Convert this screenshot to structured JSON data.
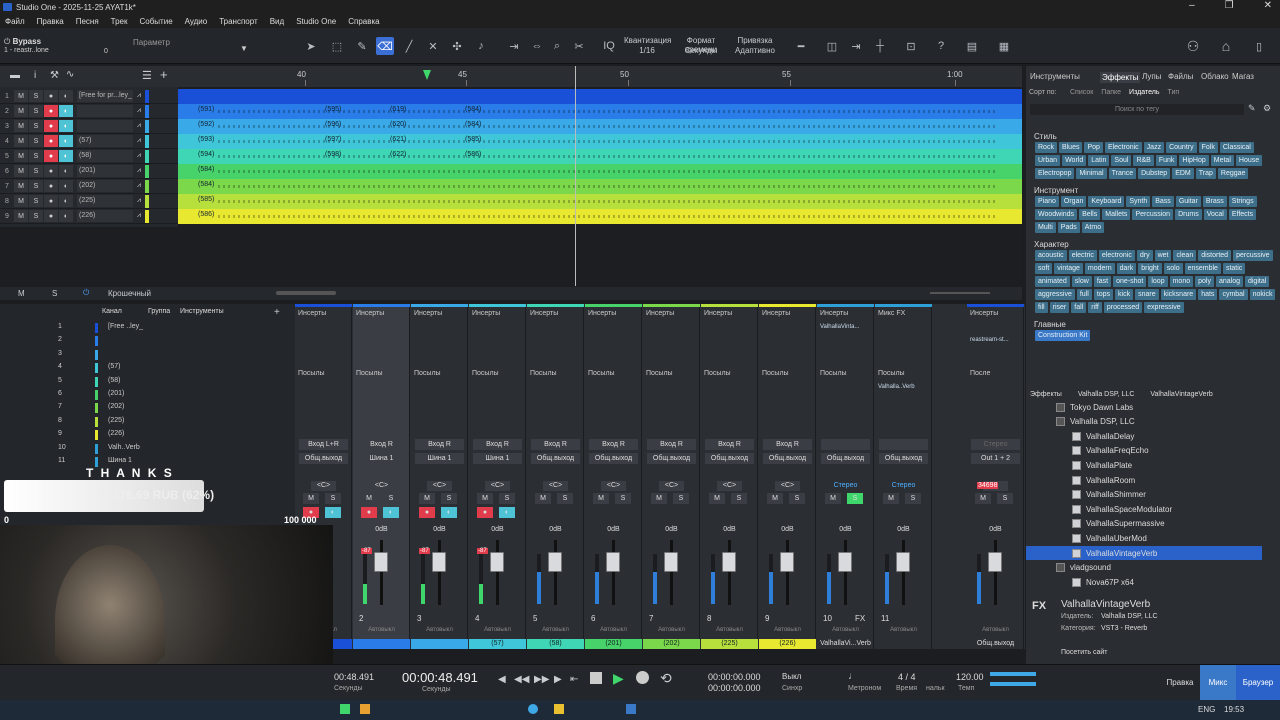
{
  "title": "Studio One - 2025-11-25 AYAT1k*",
  "menu": [
    "Файл",
    "Правка",
    "Песня",
    "Трек",
    "Событие",
    "Аудио",
    "Транспорт",
    "Вид",
    "Studio One",
    "Справка"
  ],
  "toolbar": {
    "bypass": "Bypass",
    "param": "Параметр",
    "device": "1 - reastr..lone",
    "dev_val": "0",
    "quant_label": "Квантизация",
    "quant_val": "1/16",
    "timefmt_label": "Формат времени",
    "timefmt_val": "Секунды",
    "snap_label": "Привязка",
    "snap_val": "Адаптивно"
  },
  "ruler": [
    "40",
    "45",
    "50",
    "55",
    "1:00"
  ],
  "tracks": [
    {
      "n": "1",
      "name": "[Free for pr...ley_",
      "color": "#1a4fd8"
    },
    {
      "n": "2",
      "name": "",
      "color": "#2a7de8"
    },
    {
      "n": "3",
      "name": "",
      "color": "#3aa9e8"
    },
    {
      "n": "4",
      "name": "(57)",
      "color": "#3fc7d9"
    },
    {
      "n": "5",
      "name": "(58)",
      "color": "#3fd6b5"
    },
    {
      "n": "6",
      "name": "(201)",
      "color": "#48d36a"
    },
    {
      "n": "7",
      "name": "(202)",
      "color": "#7ad84a"
    },
    {
      "n": "8",
      "name": "(225)",
      "color": "#b8e03c"
    },
    {
      "n": "9",
      "name": "(226)",
      "color": "#e8e830"
    }
  ],
  "clips": [
    [
      "(591)",
      "(595)",
      "(619)",
      "(584)"
    ],
    [
      "(592)",
      "(596)",
      "(620)",
      "(584)"
    ],
    [
      "(593)",
      "(597)",
      "(621)",
      "(585)"
    ],
    [
      "(594)",
      "(598)",
      "(622)",
      "(586)"
    ],
    [
      "(584)"
    ],
    [
      "(584)"
    ],
    [
      "(585)"
    ],
    [
      "(586)"
    ]
  ],
  "arrange_footer": {
    "m": "M",
    "s": "S",
    "mode": "Крошечный"
  },
  "browser": {
    "tabs": [
      "Инструменты",
      "Эффекты",
      "Лупы",
      "Файлы",
      "Облако",
      "Магаз"
    ],
    "sort_label": "Сорт по:",
    "sort_opts": [
      "Список",
      "Папке",
      "Издатель",
      "Тип"
    ],
    "search_placeholder": "Поиск по тегу",
    "style_title": "Стиль",
    "style_tags": [
      "Rock",
      "Blues",
      "Pop",
      "Electronic",
      "Jazz",
      "Country",
      "Folk",
      "Classical",
      "Urban",
      "World",
      "Latin",
      "Soul",
      "R&B",
      "Funk",
      "HipHop",
      "Metal",
      "House",
      "Electropop",
      "Minimal",
      "Trance",
      "Dubstep",
      "EDM",
      "Trap",
      "Reggae"
    ],
    "instr_title": "Инструмент",
    "instr_tags": [
      "Piano",
      "Organ",
      "Keyboard",
      "Synth",
      "Bass",
      "Guitar",
      "Brass",
      "Strings",
      "Woodwinds",
      "Bells",
      "Mallets",
      "Percussion",
      "Drums",
      "Vocal",
      "Effects",
      "Multi",
      "Pads",
      "Atmo"
    ],
    "char_title": "Характер",
    "char_tags": [
      "acoustic",
      "electric",
      "electronic",
      "dry",
      "wet",
      "clean",
      "distorted",
      "percussive",
      "soft",
      "vintage",
      "modern",
      "dark",
      "bright",
      "solo",
      "ensemble",
      "static",
      "animated",
      "slow",
      "fast",
      "one-shot",
      "loop",
      "mono",
      "poly",
      "analog",
      "digital",
      "aggressive",
      "full",
      "tops",
      "kick",
      "snare",
      "kicksnare",
      "hats",
      "cymbal",
      "nokick",
      "fill",
      "riser",
      "fall",
      "riff",
      "processed",
      "expressive"
    ],
    "main_title": "Главные",
    "main_tags": [
      "Construction Kit"
    ],
    "path": [
      "Эффекты",
      "Valhalla DSP, LLC",
      "ValhallaVintageVerb"
    ],
    "tree": [
      "Tokyo Dawn Labs",
      "Valhalla DSP, LLC",
      "ValhallaDelay",
      "ValhallaFreqEcho",
      "ValhallaPlate",
      "ValhallaRoom",
      "ValhallaShimmer",
      "ValhallaSpaceModulator",
      "ValhallaSupermassive",
      "ValhallaUberMod",
      "ValhallaVintageVerb",
      "vladgsound",
      "Nova67P x64"
    ],
    "info_name": "ValhallaVintageVerb",
    "info_vendor_l": "Издатель:",
    "info_vendor": "Valhalla DSP, LLC",
    "info_cat_l": "Категория:",
    "info_cat": "VST3 - Reverb",
    "visit": "Посетить сайт"
  },
  "console_left": {
    "h_channel": "Канал",
    "h_group": "Группа",
    "h_instr": "Инструменты",
    "rows": [
      "[Free ..ley_",
      "",
      "",
      "(57)",
      "(58)",
      "(201)",
      "(202)",
      "(225)",
      "(226)",
      "Valh..Verb",
      "Шина 1"
    ],
    "nums": [
      "1",
      "2",
      "3",
      "4",
      "5",
      "6",
      "7",
      "8",
      "9",
      "10",
      "11"
    ]
  },
  "channels": [
    {
      "num": "",
      "in": "Вход L+R",
      "out": "Общ.выход",
      "pan": "<C>",
      "vol": "0dB",
      "color": "#1a4fd8",
      "foot": "..ley_",
      "rec": true,
      "mon": "#4fc3d6",
      "peak": "-87"
    },
    {
      "num": "2",
      "in": "Вход R",
      "out": "Шина 1",
      "pan": "<C>",
      "vol": "0dB",
      "color": "#2a7de8",
      "foot": "",
      "rec": true,
      "mon": "#4fc3d6",
      "peak": "-87"
    },
    {
      "num": "3",
      "in": "Вход R",
      "out": "Шина 1",
      "pan": "<C>",
      "vol": "0dB",
      "color": "#3aa9e8",
      "foot": "",
      "rec": true,
      "mon": "#4fc3d6",
      "peak": "-87"
    },
    {
      "num": "4",
      "in": "Вход R",
      "out": "Шина 1",
      "pan": "<C>",
      "vol": "0dB",
      "color": "#3fc7d9",
      "foot": "(57)",
      "rec": true,
      "mon": "#4fc3d6",
      "peak": "-87"
    },
    {
      "num": "5",
      "in": "Вход R",
      "out": "Общ.выход",
      "pan": "<C>",
      "vol": "0dB",
      "color": "#3fd6b5",
      "foot": "(58)",
      "rec": false,
      "mon": "",
      "peak": ""
    },
    {
      "num": "6",
      "in": "Вход R",
      "out": "Общ.выход",
      "pan": "<C>",
      "vol": "0dB",
      "color": "#48d36a",
      "foot": "(201)",
      "rec": false,
      "mon": "",
      "peak": ""
    },
    {
      "num": "7",
      "in": "Вход R",
      "out": "Общ.выход",
      "pan": "<C>",
      "vol": "0dB",
      "color": "#7ad84a",
      "foot": "(202)",
      "rec": false,
      "mon": "",
      "peak": ""
    },
    {
      "num": "8",
      "in": "Вход R",
      "out": "Общ.выход",
      "pan": "<C>",
      "vol": "0dB",
      "color": "#b8e03c",
      "foot": "(225)",
      "rec": false,
      "mon": "",
      "peak": ""
    },
    {
      "num": "9",
      "in": "Вход R",
      "out": "Общ.выход",
      "pan": "<C>",
      "vol": "0dB",
      "color": "#e8e830",
      "foot": "(226)",
      "rec": false,
      "mon": "",
      "peak": ""
    },
    {
      "num": "10",
      "in": "",
      "out": "Общ.выход",
      "pan": "Стерео",
      "vol": "0dB",
      "color": "#2f9fd8",
      "foot": "ValhallaVi...Verb",
      "rec": false,
      "mon": "",
      "peak": ""
    },
    {
      "num": "11",
      "in": "",
      "out": "Общ.выход",
      "pan": "Стерео",
      "vol": "0dB",
      "color": "#2f9fd8",
      "foot": "",
      "rec": false,
      "mon": "",
      "peak": ""
    },
    {
      "num": "",
      "in": "",
      "out": "Out 1 + 2",
      "pan": "",
      "vol": "0dB",
      "color": "#1a4fd8",
      "foot": "Общ.выход",
      "rec": false,
      "mon": "",
      "peak": "34698"
    }
  ],
  "console_labels": {
    "inserts": "Инсерты",
    "sends": "Посылы",
    "fx_mix": "Микс FX",
    "post": "После",
    "stereo": "Стерео",
    "auto": "Автовыкл",
    "valhalla_ins": "ValhallaVinta...",
    "reastream": "reastream-st...",
    "valh_send": "Valhalla..Verb",
    "m": "M",
    "s": "S",
    "fx": "FX",
    "fxnum": "10"
  },
  "transport": {
    "time_left": "00:48.491",
    "sec_left": "Секунды",
    "time_main": "00:00:48.491",
    "sec_main": "Секунды",
    "l": "00:00:00.000",
    "r": "00:00:00.000",
    "sync": "Выкл",
    "sync_l": "Синхр",
    "metro": "Метроном",
    "sig": "4 / 4",
    "sig_l": "Время",
    "tempo": "120.00",
    "tempo_l": "Темп",
    "nal": "нальк",
    "edit": "Правка",
    "mix": "Микс",
    "browse": "Браузер"
  },
  "overlay": {
    "thanks": "T H A N K S",
    "amount": "62 376.69 RUB (62%)",
    "start": "0",
    "goal": "100 000"
  },
  "taskbar": {
    "lang": "ENG",
    "time": "19:53"
  }
}
